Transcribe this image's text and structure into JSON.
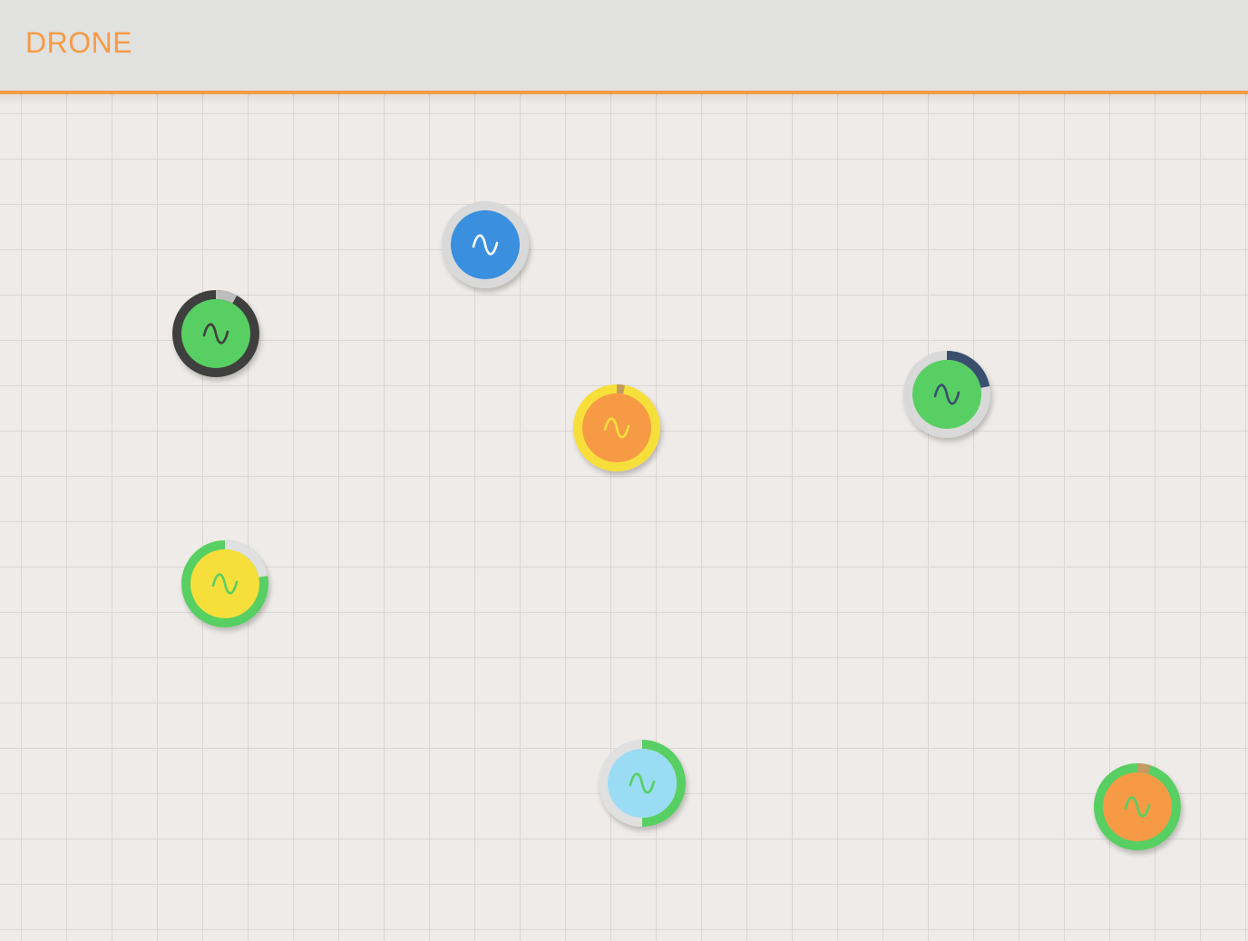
{
  "app": {
    "title": "DRONE",
    "colors": {
      "accent": "#f79a45",
      "header_bg": "#e1e1e0",
      "canvas_bg": "#eeebe8",
      "grid_line": "#d9d6d3"
    }
  },
  "nodes": [
    {
      "id": "node-blue",
      "fill": "#3a8fdf",
      "ring_bg": "#d9d9d9",
      "ring_fg": "#d9d9d9",
      "arc": 0.0,
      "arc_color": "#d9d9d9",
      "icon": "sine-wave-icon",
      "icon_color": "#ffffff",
      "value": 0.0
    },
    {
      "id": "node-green-dark",
      "fill": "#58cf62",
      "ring_bg": "#3f3f3f",
      "ring_fg": "#3f3f3f",
      "arc": 0.08,
      "arc_color": "#bdbdbd",
      "icon": "sine-wave-icon",
      "icon_color": "#3f3f3f",
      "value": 0.92
    },
    {
      "id": "node-orange",
      "fill": "#f79a45",
      "ring_bg": "#f7df3b",
      "ring_fg": "#f7df3b",
      "arc": 0.03,
      "arc_color": "#c49a63",
      "icon": "sine-wave-icon",
      "icon_color": "#f7df3b",
      "value": 0.97
    },
    {
      "id": "node-green-navy",
      "fill": "#58cf62",
      "ring_bg": "#d9d9d9",
      "ring_fg": "#3a4e6e",
      "arc": 0.22,
      "arc_color": "#3a4e6e",
      "icon": "sine-wave-icon",
      "icon_color": "#3a4e6e",
      "value": 0.22
    },
    {
      "id": "node-yellow",
      "fill": "#f7df3b",
      "ring_bg": "#58cf62",
      "ring_fg": "#58cf62",
      "arc": 0.22,
      "arc_color": "#e0e0e0",
      "icon": "sine-wave-icon",
      "icon_color": "#58cf62",
      "value": 0.78
    },
    {
      "id": "node-lightblue",
      "fill": "#9bdcf5",
      "ring_bg": "#e0e0e0",
      "ring_fg": "#58cf62",
      "arc": 0.5,
      "arc_color": "#58cf62",
      "icon": "sine-wave-icon",
      "icon_color": "#58cf62",
      "value": 0.5
    },
    {
      "id": "node-orange-green",
      "fill": "#f79a45",
      "ring_bg": "#58cf62",
      "ring_fg": "#58cf62",
      "arc": 0.05,
      "arc_color": "#c49a63",
      "icon": "sine-wave-icon",
      "icon_color": "#58cf62",
      "value": 0.95
    }
  ]
}
